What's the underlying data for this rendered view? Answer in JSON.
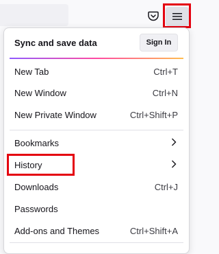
{
  "menu": {
    "sync_label": "Sync and save data",
    "sign_in_label": "Sign In",
    "items": [
      {
        "label": "New Tab",
        "shortcut": "Ctrl+T"
      },
      {
        "label": "New Window",
        "shortcut": "Ctrl+N"
      },
      {
        "label": "New Private Window",
        "shortcut": "Ctrl+Shift+P"
      },
      {
        "label": "Bookmarks"
      },
      {
        "label": "History"
      },
      {
        "label": "Downloads",
        "shortcut": "Ctrl+J"
      },
      {
        "label": "Passwords"
      },
      {
        "label": "Add-ons and Themes",
        "shortcut": "Ctrl+Shift+A"
      }
    ]
  },
  "icons": {
    "pocket": "pocket-icon",
    "menu": "hamburger-menu-icon",
    "submenu": "chevron-right-icon"
  },
  "colors": {
    "highlight": "#e4000f",
    "accent_gradient": [
      "#9059ff",
      "#ff4aa2",
      "#ffbd4f"
    ]
  }
}
